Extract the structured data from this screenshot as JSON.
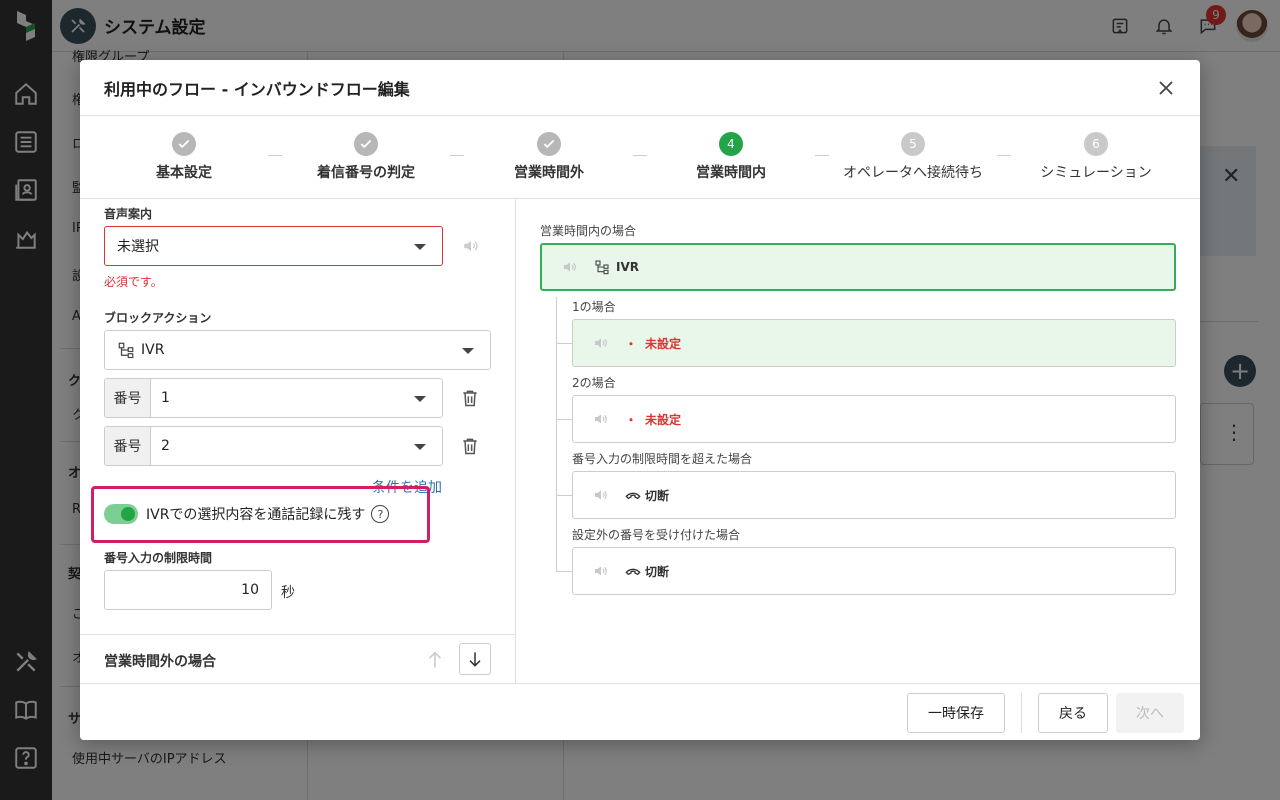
{
  "app": {
    "page_title": "システム設定",
    "notification_badge": "9"
  },
  "subnav": {
    "items": [
      "権限グループ",
      "権",
      "ロ",
      "監",
      "IP",
      "設",
      "A"
    ],
    "section_ku": "ク",
    "item_ku": "ク",
    "section_o": "オ",
    "item_r": "R",
    "section_kei": "契",
    "item_ko": "ご",
    "item_o": "オ",
    "section_sa": "サ",
    "item_ip": "使用中サーバのIPアドレス"
  },
  "modal": {
    "title": "利用中のフロー - インバウンドフロー編集",
    "steps": [
      {
        "label": "基本設定",
        "state": "done",
        "num": ""
      },
      {
        "label": "着信番号の判定",
        "state": "done",
        "num": ""
      },
      {
        "label": "営業時間外",
        "state": "done",
        "num": ""
      },
      {
        "label": "営業時間内",
        "state": "active",
        "num": "4"
      },
      {
        "label": "オペレータへ接続待ち",
        "state": "todo",
        "num": "5"
      },
      {
        "label": "シミュレーション",
        "state": "todo",
        "num": "6"
      }
    ],
    "form": {
      "voice_label": "音声案内",
      "voice_value": "未選択",
      "voice_error": "必須です。",
      "block_label": "ブロックアクション",
      "block_value": "IVR",
      "number_addon": "番号",
      "number_1": "1",
      "number_2": "2",
      "add_condition": "条件を追加",
      "record_toggle_label": "IVRでの選択内容を通話記録に残す",
      "record_toggle_on": true,
      "help_glyph": "?",
      "timeout_label": "番号入力の制限時間",
      "timeout_value": "10",
      "timeout_unit": "秒",
      "next_section": "営業時間外の場合"
    },
    "preview": {
      "caption": "営業時間内の場合",
      "top_action": "IVR",
      "branches": [
        {
          "caption": "1の場合",
          "dot": "・",
          "value": "未設定",
          "highlight": true
        },
        {
          "caption": "2の場合",
          "dot": "・",
          "value": "未設定",
          "highlight": false
        },
        {
          "caption": "番号入力の制限時間を超えた場合",
          "value": "切断"
        },
        {
          "caption": "設定外の番号を受け付けた場合",
          "value": "切断"
        }
      ]
    },
    "footer": {
      "save_temp": "一時保存",
      "back": "戻る",
      "next": "次へ"
    }
  },
  "colors": {
    "accent_green": "#22a447",
    "error_red": "#d33333",
    "link_blue": "#2f73b5",
    "highlight_pink": "#d21f64"
  }
}
